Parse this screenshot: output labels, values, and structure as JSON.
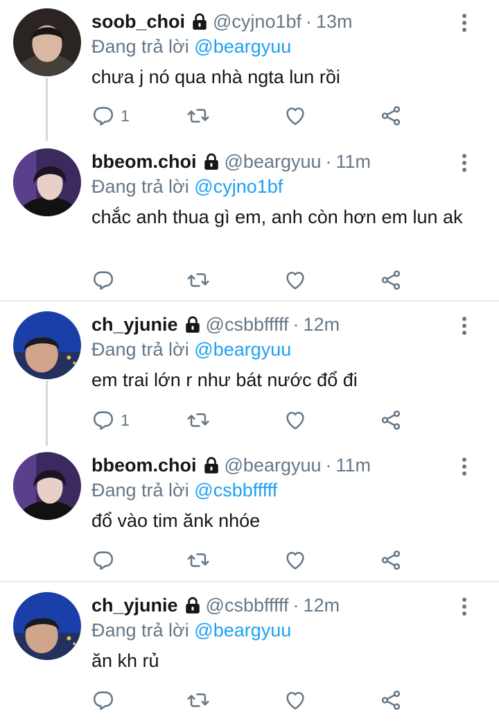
{
  "tweets": [
    {
      "name": "soob_choi",
      "handle": "@cyjno1bf",
      "time": "13m",
      "reply_label": "Đang trả lời",
      "reply_to": "@beargyuu",
      "text": "chưa j nó qua nhà ngta lun rồi",
      "reply_count": "1",
      "icons": {
        "lock": "lock-icon",
        "reply": "reply-icon",
        "retweet": "retweet-icon",
        "like": "heart-icon",
        "share": "share-icon",
        "more": "more-icon"
      }
    },
    {
      "name": "bbeom.choi",
      "handle": "@beargyuu",
      "time": "11m",
      "reply_label": "Đang trả lời",
      "reply_to": "@cyjno1bf",
      "text": "chắc anh thua gì em, anh còn hơn em lun ak",
      "reply_count": ""
    },
    {
      "name": "ch_yjunie",
      "handle": "@csbbfffff",
      "time": "12m",
      "reply_label": "Đang trả lời",
      "reply_to": "@beargyuu",
      "text": "em trai lớn r như bát nước đổ đi",
      "reply_count": "1"
    },
    {
      "name": "bbeom.choi",
      "handle": "@beargyuu",
      "time": "11m",
      "reply_label": "Đang trả lời",
      "reply_to": "@csbbfffff",
      "text": "đổ vào tim ănk nhóe",
      "reply_count": ""
    },
    {
      "name": "ch_yjunie",
      "handle": "@csbbfffff",
      "time": "12m",
      "reply_label": "Đang trả lời",
      "reply_to": "@beargyuu",
      "text": "ăn kh rủ",
      "reply_count": ""
    }
  ],
  "separator": "·",
  "colors": {
    "link": "#1da1f2",
    "muted": "#657786",
    "text": "#14171a",
    "divider": "#e6ecf0",
    "thread_line": "#cfd9de"
  }
}
